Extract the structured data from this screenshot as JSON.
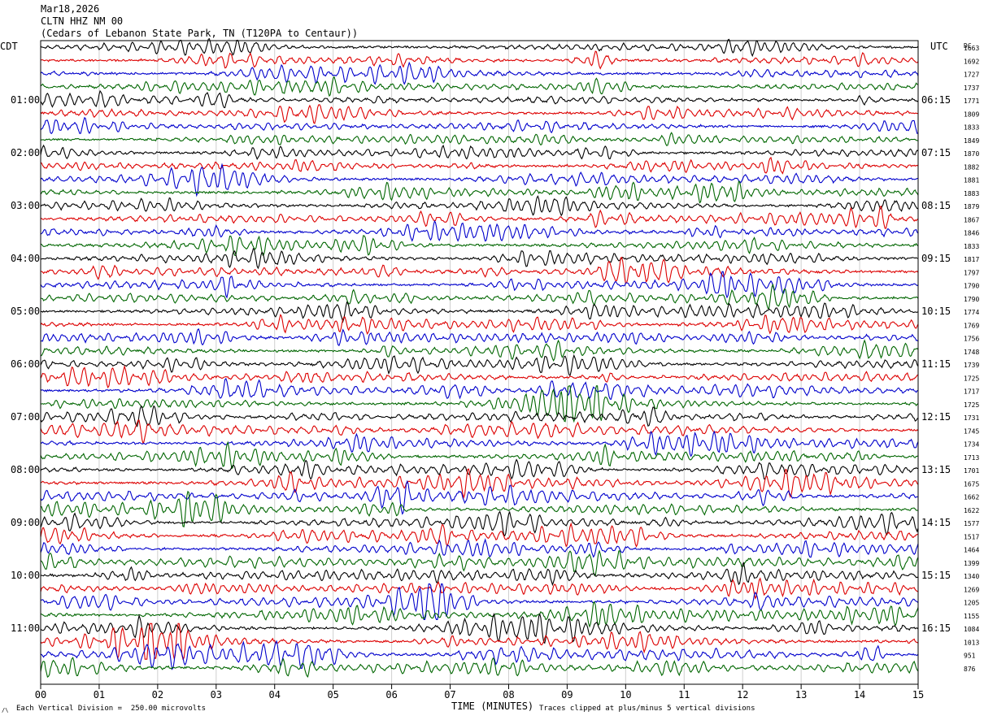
{
  "header": {
    "date": "Mar18,2026",
    "station": "CLTN HHZ NM 00",
    "location": "(Cedars of Lebanon State Park, TN (T120PA to Centaur))"
  },
  "left_timezone": "CDT",
  "right_timezone": "UTC",
  "dc_label": "DC",
  "footer": {
    "scale_note": "Each Vertical Division =  250.00 microvolts",
    "clip_note": "Traces clipped at plus/minus 5 vertical divisions",
    "mark": "/\\"
  },
  "chart_data": {
    "type": "line",
    "kind": "helicorder",
    "xlabel": "TIME (MINUTES)",
    "x_ticks": [
      "00",
      "01",
      "02",
      "03",
      "04",
      "05",
      "06",
      "07",
      "08",
      "09",
      "10",
      "11",
      "12",
      "13",
      "14",
      "15"
    ],
    "xlim": [
      0,
      15
    ],
    "line_count": 48,
    "line_duration_minutes": 15,
    "trace_colors": [
      "#000000",
      "#dd0000",
      "#0000cc",
      "#006600"
    ],
    "left_hour_labels": [
      "01:00",
      "02:00",
      "03:00",
      "04:00",
      "05:00",
      "06:00",
      "07:00",
      "08:00",
      "09:00",
      "10:00",
      "11:00"
    ],
    "right_hour_labels": [
      "06:15",
      "07:15",
      "08:15",
      "09:15",
      "10:15",
      "11:15",
      "12:15",
      "13:15",
      "14:15",
      "15:15",
      "16:15"
    ],
    "hour_label_rows": [
      4,
      8,
      12,
      16,
      20,
      24,
      28,
      32,
      36,
      40,
      44
    ],
    "dc_offsets": [
      "1663",
      "1692",
      "1727",
      "1737",
      "1771",
      "1809",
      "1833",
      "1849",
      "1870",
      "1882",
      "1881",
      "1883",
      "1879",
      "1867",
      "1846",
      "1833",
      "1817",
      "1797",
      "1790",
      "1790",
      "1774",
      "1769",
      "1756",
      "1748",
      "1739",
      "1725",
      "1717",
      "1725",
      "1731",
      "1745",
      "1734",
      "1713",
      "1701",
      "1675",
      "1662",
      "1622",
      "1577",
      "1517",
      "1464",
      "1399",
      "1340",
      "1269",
      "1205",
      "1155",
      "1084",
      "1013",
      "951",
      "876"
    ]
  }
}
